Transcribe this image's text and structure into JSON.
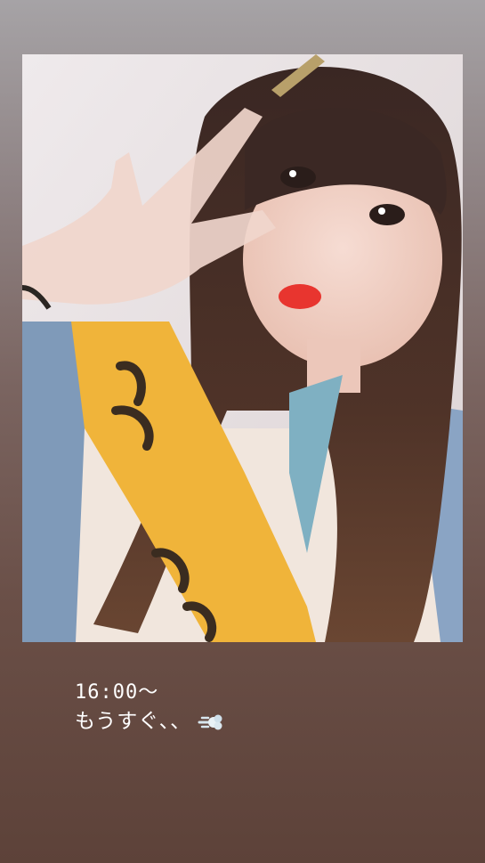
{
  "story": {
    "caption_time": "16:00〜",
    "caption_text": "もうすぐ、、",
    "caption_icon": "dash-emoji-icon"
  },
  "colors": {
    "background_top": "#a6a3a6",
    "background_bottom": "#5d4239",
    "caption_text": "#ffffff",
    "sash": "#f0b43a"
  }
}
